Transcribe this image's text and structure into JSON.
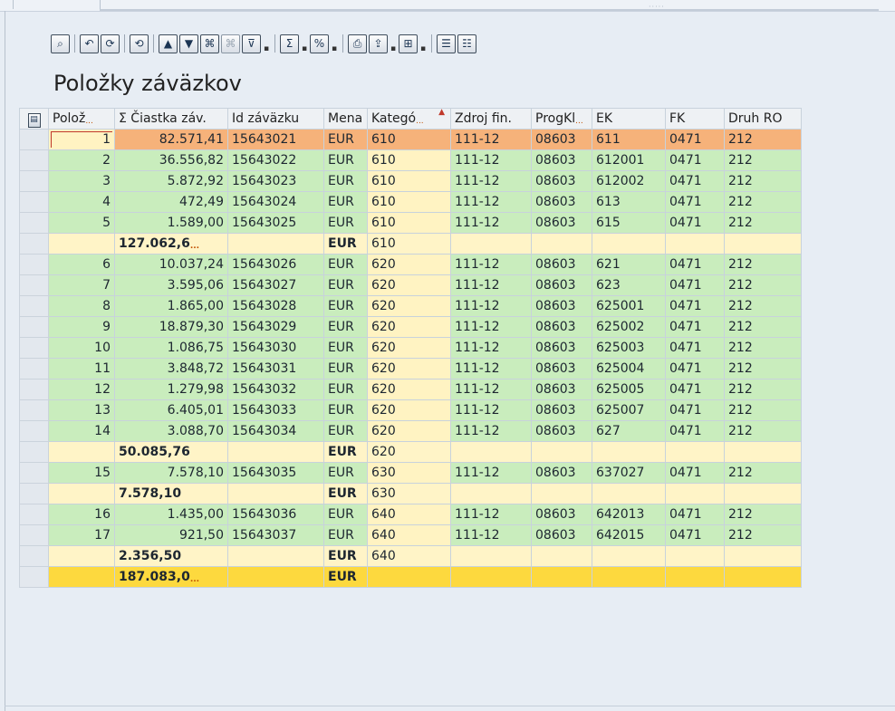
{
  "page": {
    "title": "Položky záväzkov"
  },
  "toolbar": {
    "items": [
      {
        "name": "details-button",
        "icon": "⌕",
        "interactable": true
      },
      {
        "name": "sep"
      },
      {
        "name": "refresh-button",
        "icon": "↶",
        "interactable": true
      },
      {
        "name": "reload-button",
        "icon": "⟳",
        "interactable": true
      },
      {
        "name": "sep"
      },
      {
        "name": "undo-button",
        "icon": "⟲",
        "interactable": true
      },
      {
        "name": "sep"
      },
      {
        "name": "sort-ascending-button",
        "icon": "▲",
        "interactable": true
      },
      {
        "name": "sort-descending-button",
        "icon": "▼",
        "interactable": true
      },
      {
        "name": "find-button",
        "icon": "⌘",
        "interactable": true
      },
      {
        "name": "find-next-button",
        "icon": "⌘",
        "interactable": false,
        "disabled": true
      },
      {
        "name": "filter-button",
        "icon": "⊽",
        "interactable": true,
        "dropdown": true
      },
      {
        "name": "sep"
      },
      {
        "name": "sum-button",
        "icon": "Σ",
        "interactable": true,
        "dropdown": true
      },
      {
        "name": "subtotal-button",
        "icon": "%",
        "interactable": true,
        "dropdown": true
      },
      {
        "name": "sep"
      },
      {
        "name": "print-button",
        "icon": "⎙",
        "interactable": true
      },
      {
        "name": "export-button",
        "icon": "⇪",
        "interactable": true,
        "dropdown": true
      },
      {
        "name": "layout-button",
        "icon": "⊞",
        "interactable": true,
        "dropdown": true
      },
      {
        "name": "sep"
      },
      {
        "name": "select-layout-button",
        "icon": "☰",
        "interactable": true
      },
      {
        "name": "save-layout-button",
        "icon": "☷",
        "interactable": true
      }
    ]
  },
  "grid": {
    "columns": [
      {
        "label": "Polož",
        "truncated": true
      },
      {
        "label": "Σ Čiastka záv.",
        "truncated": false
      },
      {
        "label": "Id záväzku",
        "truncated": false
      },
      {
        "label": "Mena",
        "truncated": false
      },
      {
        "label": "Kategó",
        "truncated": true,
        "sorted": true
      },
      {
        "label": "Zdroj fin.",
        "truncated": false
      },
      {
        "label": "ProgKl",
        "truncated": true
      },
      {
        "label": "EK",
        "truncated": false
      },
      {
        "label": "FK",
        "truncated": false
      },
      {
        "label": "Druh RO",
        "truncated": false
      }
    ],
    "rows": [
      {
        "type": "hl",
        "cells": [
          "1",
          "82.571,41",
          "15643021",
          "EUR",
          "610",
          "111-12",
          "08603",
          "611",
          "0471",
          "212"
        ]
      },
      {
        "type": "g",
        "cells": [
          "2",
          "36.556,82",
          "15643022",
          "EUR",
          "610",
          "111-12",
          "08603",
          "612001",
          "0471",
          "212"
        ]
      },
      {
        "type": "g",
        "cells": [
          "3",
          "5.872,92",
          "15643023",
          "EUR",
          "610",
          "111-12",
          "08603",
          "612002",
          "0471",
          "212"
        ]
      },
      {
        "type": "g",
        "cells": [
          "4",
          "472,49",
          "15643024",
          "EUR",
          "610",
          "111-12",
          "08603",
          "613",
          "0471",
          "212"
        ]
      },
      {
        "type": "g",
        "cells": [
          "5",
          "1.589,00",
          "15643025",
          "EUR",
          "610",
          "111-12",
          "08603",
          "615",
          "0471",
          "212"
        ]
      },
      {
        "type": "s",
        "cells": [
          "",
          "127.062,6",
          "",
          "EUR",
          "610",
          "",
          "",
          "",
          "",
          ""
        ],
        "truncated": true
      },
      {
        "type": "g",
        "cells": [
          "6",
          "10.037,24",
          "15643026",
          "EUR",
          "620",
          "111-12",
          "08603",
          "621",
          "0471",
          "212"
        ]
      },
      {
        "type": "g",
        "cells": [
          "7",
          "3.595,06",
          "15643027",
          "EUR",
          "620",
          "111-12",
          "08603",
          "623",
          "0471",
          "212"
        ]
      },
      {
        "type": "g",
        "cells": [
          "8",
          "1.865,00",
          "15643028",
          "EUR",
          "620",
          "111-12",
          "08603",
          "625001",
          "0471",
          "212"
        ]
      },
      {
        "type": "g",
        "cells": [
          "9",
          "18.879,30",
          "15643029",
          "EUR",
          "620",
          "111-12",
          "08603",
          "625002",
          "0471",
          "212"
        ]
      },
      {
        "type": "g",
        "cells": [
          "10",
          "1.086,75",
          "15643030",
          "EUR",
          "620",
          "111-12",
          "08603",
          "625003",
          "0471",
          "212"
        ]
      },
      {
        "type": "g",
        "cells": [
          "11",
          "3.848,72",
          "15643031",
          "EUR",
          "620",
          "111-12",
          "08603",
          "625004",
          "0471",
          "212"
        ]
      },
      {
        "type": "g",
        "cells": [
          "12",
          "1.279,98",
          "15643032",
          "EUR",
          "620",
          "111-12",
          "08603",
          "625005",
          "0471",
          "212"
        ]
      },
      {
        "type": "g",
        "cells": [
          "13",
          "6.405,01",
          "15643033",
          "EUR",
          "620",
          "111-12",
          "08603",
          "625007",
          "0471",
          "212"
        ]
      },
      {
        "type": "g",
        "cells": [
          "14",
          "3.088,70",
          "15643034",
          "EUR",
          "620",
          "111-12",
          "08603",
          "627",
          "0471",
          "212"
        ]
      },
      {
        "type": "s",
        "cells": [
          "",
          "50.085,76",
          "",
          "EUR",
          "620",
          "",
          "",
          "",
          "",
          ""
        ]
      },
      {
        "type": "g",
        "cells": [
          "15",
          "7.578,10",
          "15643035",
          "EUR",
          "630",
          "111-12",
          "08603",
          "637027",
          "0471",
          "212"
        ]
      },
      {
        "type": "s",
        "cells": [
          "",
          "7.578,10",
          "",
          "EUR",
          "630",
          "",
          "",
          "",
          "",
          ""
        ]
      },
      {
        "type": "g",
        "cells": [
          "16",
          "1.435,00",
          "15643036",
          "EUR",
          "640",
          "111-12",
          "08603",
          "642013",
          "0471",
          "212"
        ]
      },
      {
        "type": "g",
        "cells": [
          "17",
          "921,50",
          "15643037",
          "EUR",
          "640",
          "111-12",
          "08603",
          "642015",
          "0471",
          "212"
        ]
      },
      {
        "type": "s",
        "cells": [
          "",
          "2.356,50",
          "",
          "EUR",
          "640",
          "",
          "",
          "",
          "",
          ""
        ]
      },
      {
        "type": "t",
        "cells": [
          "",
          "187.083,0",
          "",
          "EUR",
          "",
          "",
          "",
          "",
          "",
          ""
        ],
        "truncated": true
      }
    ]
  },
  "colors": {
    "row_green": "#c9edbd",
    "row_selected": "#f6b27a",
    "subtotal": "#fff4c7",
    "total": "#fdd93e",
    "category_cell": "#fff3c2"
  }
}
